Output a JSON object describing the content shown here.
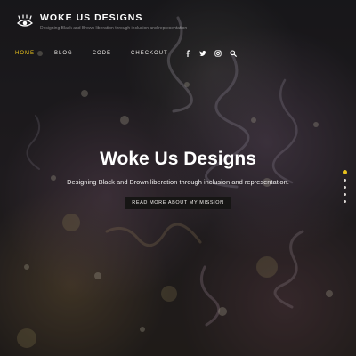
{
  "header": {
    "site_title": "WOKE US DESIGNS",
    "tagline": "Designing Black and Brown liberation through inclusion and representation",
    "logo_icon": "eye-logo-icon"
  },
  "nav": {
    "items": [
      {
        "label": "HOME",
        "active": true
      },
      {
        "label": "BLOG",
        "active": false
      },
      {
        "label": "CODE",
        "active": false
      },
      {
        "label": "CHECKOUT",
        "active": false
      }
    ],
    "icons": [
      "facebook-icon",
      "twitter-icon",
      "instagram-icon",
      "search-icon"
    ]
  },
  "hero": {
    "title": "Woke Us Designs",
    "subtitle": "Designing Black and Brown liberation through inclusion and representation.",
    "button_label": "READ MORE ABOUT MY MISSION"
  },
  "slider": {
    "dot_count": 5,
    "active_index": 0
  },
  "colors": {
    "accent": "#e8c21c",
    "button_bg": "#161514",
    "text": "#ffffff"
  }
}
